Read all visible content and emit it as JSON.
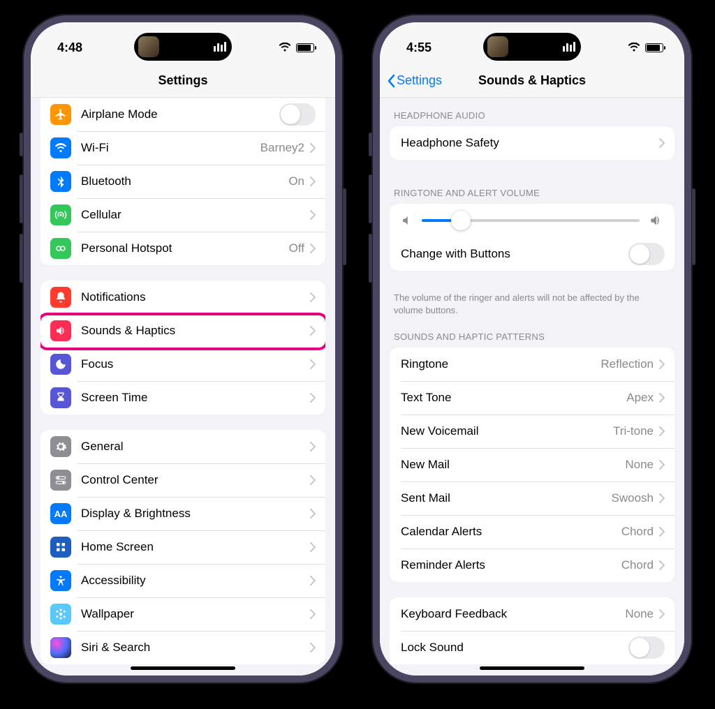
{
  "left": {
    "time": "4:48",
    "title": "Settings",
    "group1": [
      {
        "icon": "airplane",
        "color": "ic-orange",
        "label": "Airplane Mode",
        "toggle": false
      },
      {
        "icon": "wifi",
        "color": "ic-blue",
        "label": "Wi-Fi",
        "value": "Barney2"
      },
      {
        "icon": "bluetooth",
        "color": "ic-blue",
        "label": "Bluetooth",
        "value": "On"
      },
      {
        "icon": "cellular",
        "color": "ic-green",
        "label": "Cellular"
      },
      {
        "icon": "hotspot",
        "color": "ic-green",
        "label": "Personal Hotspot",
        "value": "Off"
      }
    ],
    "group2": [
      {
        "icon": "bell",
        "color": "ic-red",
        "label": "Notifications"
      },
      {
        "icon": "speaker",
        "color": "ic-pink",
        "label": "Sounds & Haptics",
        "highlight": true
      },
      {
        "icon": "moon",
        "color": "ic-indigo",
        "label": "Focus"
      },
      {
        "icon": "hourglass",
        "color": "ic-indigo",
        "label": "Screen Time"
      }
    ],
    "group3": [
      {
        "icon": "gear",
        "color": "ic-gray",
        "label": "General"
      },
      {
        "icon": "switches",
        "color": "ic-gray",
        "label": "Control Center"
      },
      {
        "icon": "aa",
        "color": "ic-blue",
        "label": "Display & Brightness"
      },
      {
        "icon": "grid",
        "color": "ic-deepblue",
        "label": "Home Screen"
      },
      {
        "icon": "person",
        "color": "ic-blue",
        "label": "Accessibility"
      },
      {
        "icon": "flower",
        "color": "ic-cyan",
        "label": "Wallpaper"
      },
      {
        "icon": "siri",
        "color": "ic-gray",
        "label": "Siri & Search"
      }
    ]
  },
  "right": {
    "time": "4:55",
    "back": "Settings",
    "title": "Sounds & Haptics",
    "sections": {
      "headphone": {
        "header": "HEADPHONE AUDIO",
        "rows": [
          {
            "label": "Headphone Safety"
          }
        ]
      },
      "ringtone_volume": {
        "header": "RINGTONE AND ALERT VOLUME",
        "slider_percent": 18,
        "change_label": "Change with Buttons",
        "change_toggle": false,
        "footer": "The volume of the ringer and alerts will not be affected by the volume buttons."
      },
      "patterns": {
        "header": "SOUNDS AND HAPTIC PATTERNS",
        "rows": [
          {
            "label": "Ringtone",
            "value": "Reflection"
          },
          {
            "label": "Text Tone",
            "value": "Apex"
          },
          {
            "label": "New Voicemail",
            "value": "Tri-tone"
          },
          {
            "label": "New Mail",
            "value": "None"
          },
          {
            "label": "Sent Mail",
            "value": "Swoosh"
          },
          {
            "label": "Calendar Alerts",
            "value": "Chord"
          },
          {
            "label": "Reminder Alerts",
            "value": "Chord"
          }
        ]
      },
      "keyboard": {
        "rows": [
          {
            "label": "Keyboard Feedback",
            "value": "None"
          },
          {
            "label": "Lock Sound",
            "toggle": false
          }
        ]
      }
    }
  }
}
